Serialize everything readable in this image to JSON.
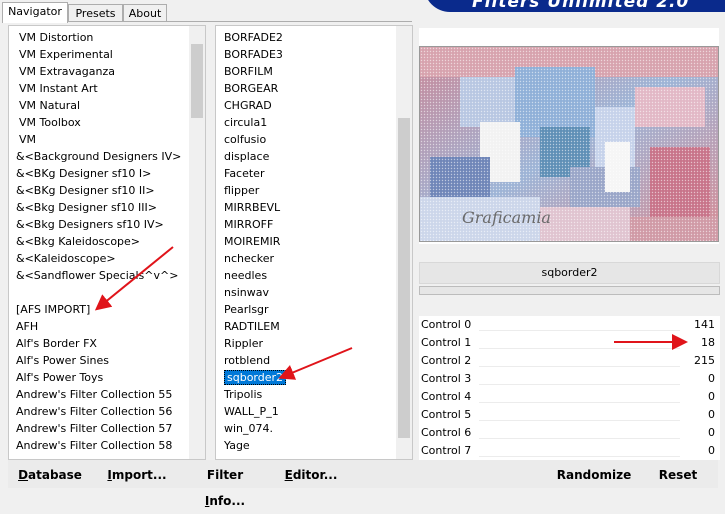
{
  "tabs": [
    "Navigator",
    "Presets",
    "About"
  ],
  "header": {
    "logo_text": "Filters Unlimited 2.0"
  },
  "categories": [
    "VM Distortion",
    "VM Experimental",
    "VM Extravaganza",
    "VM Instant Art",
    "VM Natural",
    "VM Toolbox",
    "VM",
    "&<Background Designers IV>",
    "&<BKg Designer sf10 I>",
    "&<BKg Designer sf10 II>",
    "&<Bkg Designer sf10 III>",
    "&<Bkg Designers sf10 IV>",
    "&<Bkg Kaleidoscope>",
    "&<Kaleidoscope>",
    "&<Sandflower Specials^v^>",
    "",
    "[AFS IMPORT]",
    "AFH",
    "Alf's Border FX",
    "Alf's Power Sines",
    "Alf's Power Toys",
    "Andrew's Filter Collection 55",
    "Andrew's Filter Collection 56",
    "Andrew's Filter Collection 57",
    "Andrew's Filter Collection 58"
  ],
  "filters": [
    "BORFADE2",
    "BORFADE3",
    "BORFILM",
    "BORGEAR",
    "CHGRAD",
    "circula1",
    "colfusio",
    "displace",
    "Faceter",
    "flipper",
    "MIRRBEVL",
    "MIRROFF",
    "MOIREMIR",
    "nchecker",
    "needles",
    "nsinwav",
    "Pearlsgr",
    "RADTILEM",
    "Rippler",
    "rotblend",
    "sqborder2",
    "Tripolis",
    "WALL_P_1",
    "win_074.",
    "Yage"
  ],
  "selected_filter": "sqborder2",
  "preview": {
    "watermark": "Graficamia"
  },
  "filter_name": "sqborder2",
  "controls": [
    {
      "label": "Control 0",
      "value": "141"
    },
    {
      "label": "Control 1",
      "value": "18"
    },
    {
      "label": "Control 2",
      "value": "215"
    },
    {
      "label": "Control 3",
      "value": "0"
    },
    {
      "label": "Control 4",
      "value": "0"
    },
    {
      "label": "Control 5",
      "value": "0"
    },
    {
      "label": "Control 6",
      "value": "0"
    },
    {
      "label": "Control 7",
      "value": "0"
    }
  ],
  "buttons": {
    "database": "Database",
    "import": "Import...",
    "filter_info": "Filter Info...",
    "editor": "Editor...",
    "randomize": "Randomize",
    "reset": "Reset"
  },
  "colors": {
    "arrow": "#e0141a",
    "selection": "#0078d7",
    "logo_bg": "#0a2a8c"
  }
}
